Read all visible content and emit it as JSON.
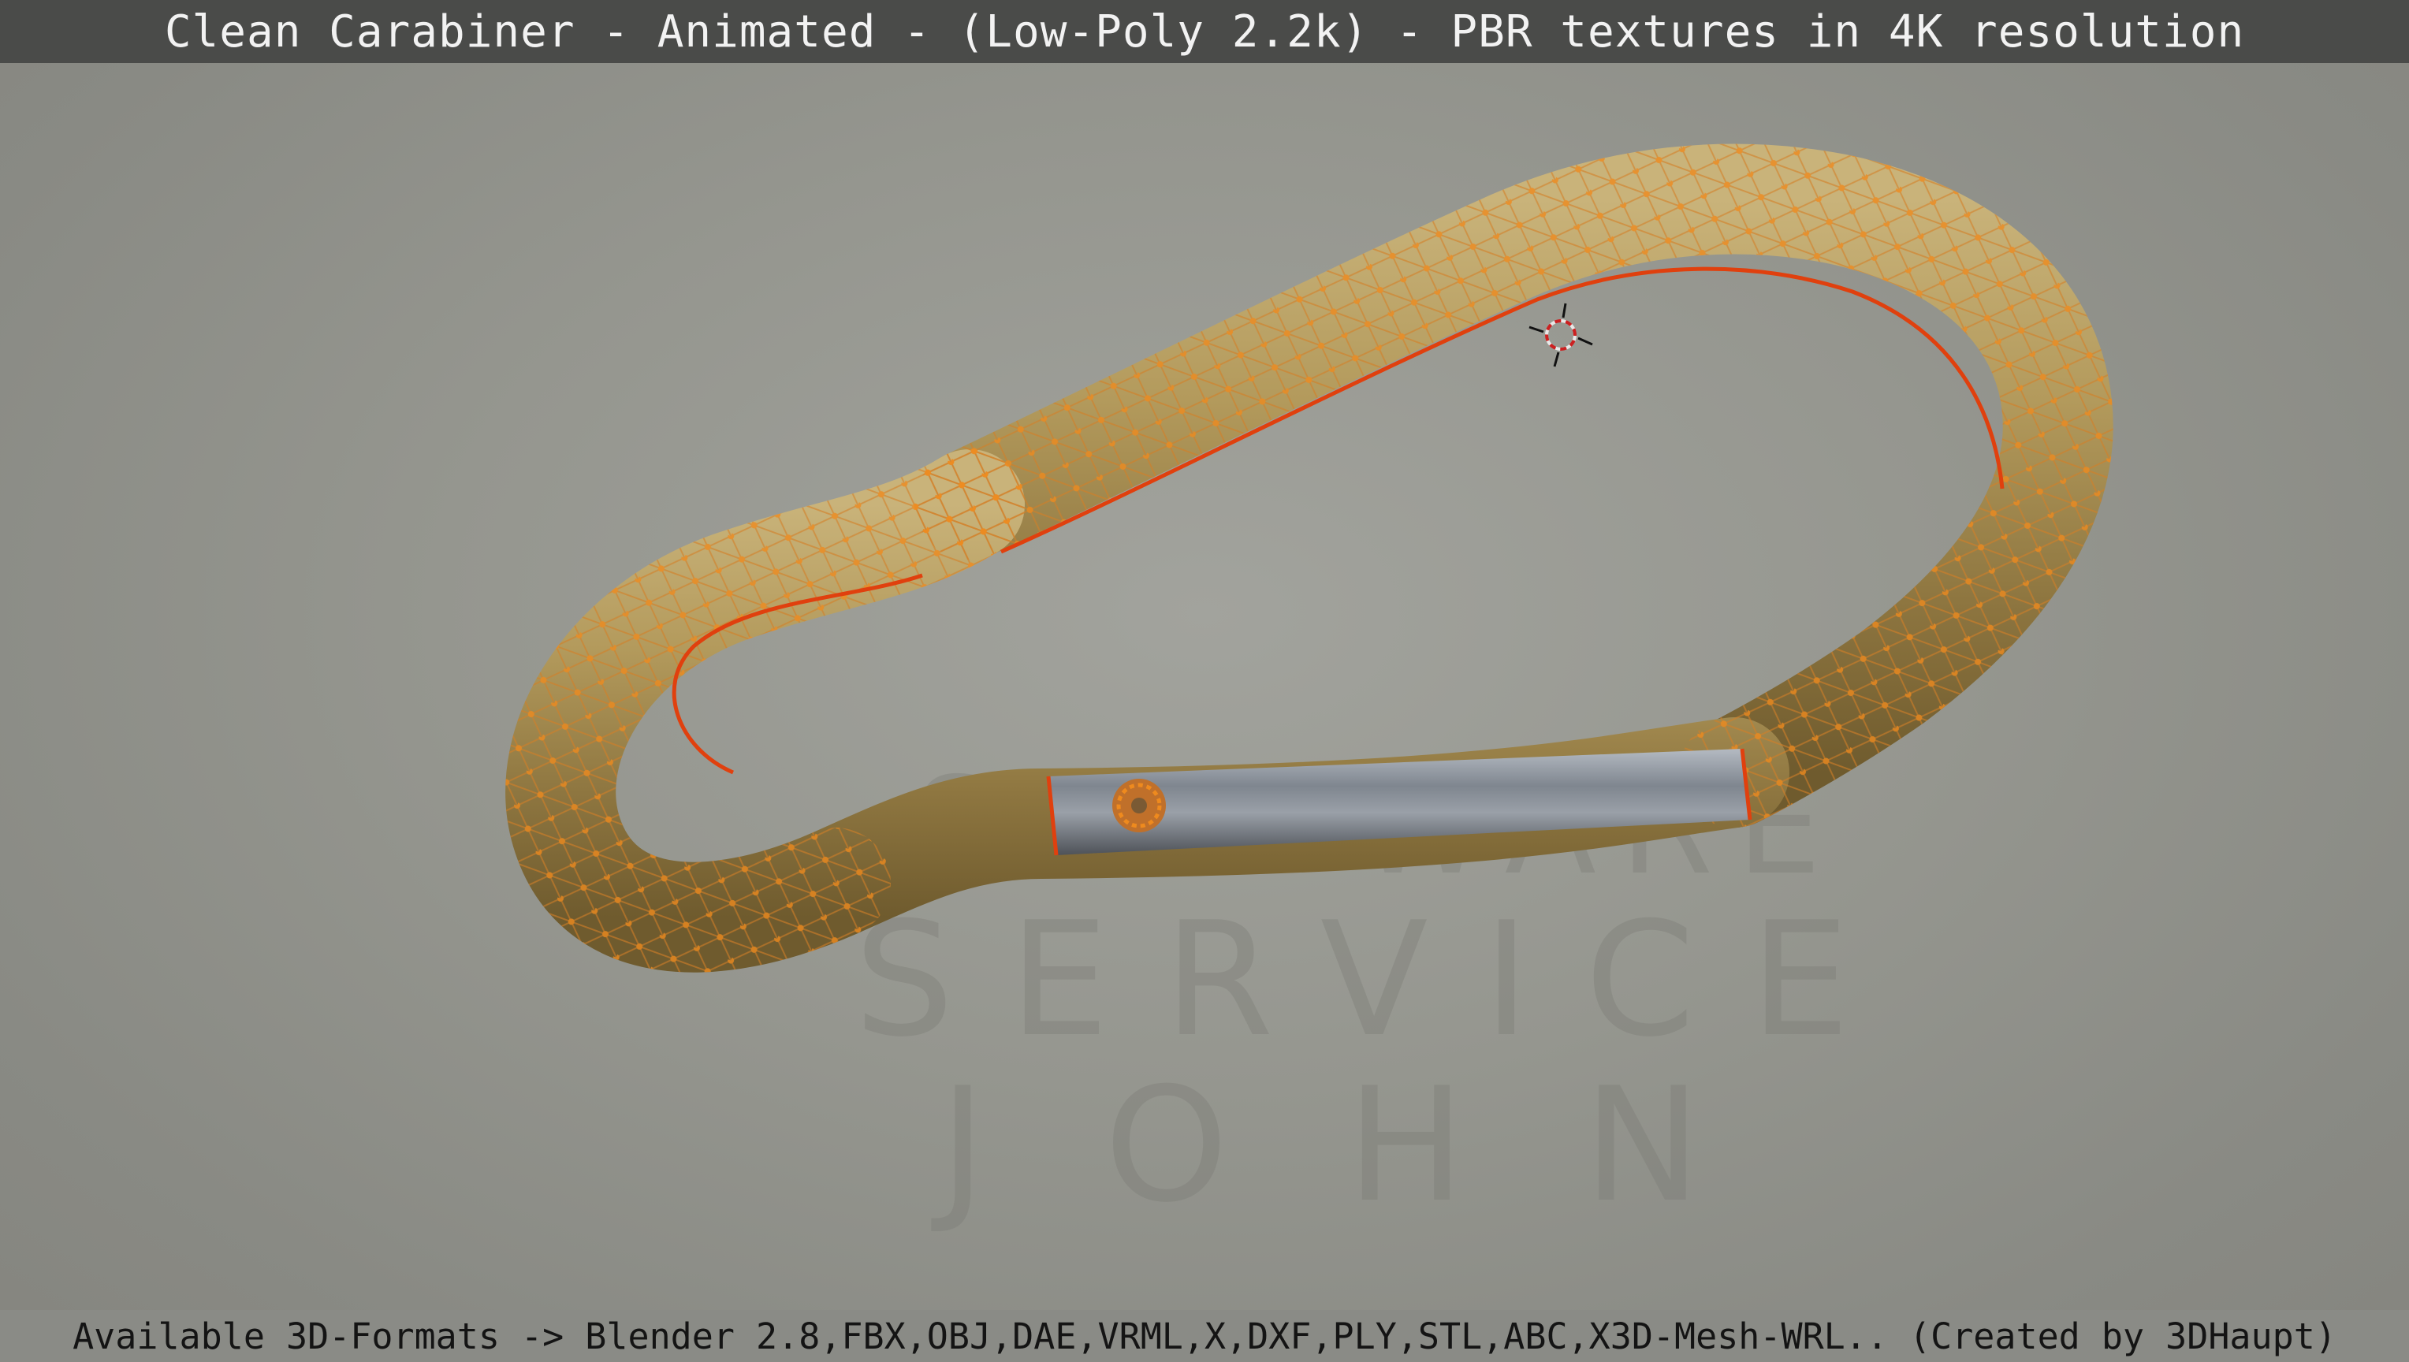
{
  "header": {
    "title": "Clean Carabiner - Animated - (Low-Poly 2.2k) - PBR textures in 4K resolution"
  },
  "footer": {
    "formats_text": "Available 3D-Formats -> Blender 2.8,FBX,OBJ,DAE,VRML,X,DXF,PLY,STL,ABC,X3D-Mesh-WRL.. (Created by 3DHaupt)"
  },
  "watermark": {
    "line1": "SOFTWARE",
    "line2": "SERVICE",
    "line3": "JOHN"
  },
  "model": {
    "name": "carabiner",
    "gold_color": "#b39a5c",
    "gate_color": "#8a8f96",
    "wire_color": "#e08a2a",
    "seam_color": "#e0400e"
  },
  "icons": {
    "origin_cursor": "3d-cursor-icon"
  }
}
